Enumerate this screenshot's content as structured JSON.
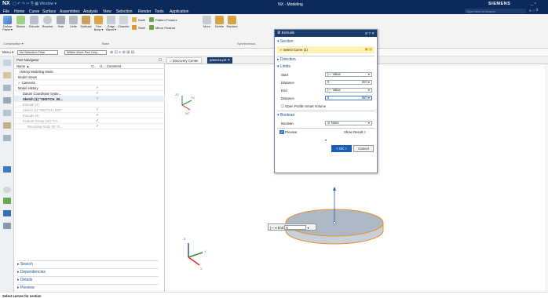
{
  "titlebar": {
    "app": "NX",
    "title": "NX - Modeling",
    "brand": "SIEMENS",
    "window_menu": "Window ▾"
  },
  "menubar": {
    "tabs": [
      "File",
      "Home",
      "Curve",
      "Surface",
      "Assemblies",
      "Analysis",
      "View",
      "Selection",
      "Render",
      "Tools",
      "Application"
    ],
    "active": "Home",
    "search_placeholder": "Type Here to Search"
  },
  "ribbon": {
    "buttons": [
      "Datum Plane ▾",
      "Sketch",
      "Extrude",
      "Revolve",
      "Hole",
      "Unite",
      "Subtract",
      "Trim Body ▾",
      "Edge Blend ▾",
      "Chamfer",
      "More",
      "Delete",
      "Replace"
    ],
    "small": [
      "Draft",
      "Pattern Feature",
      "Shell",
      "Mirror Feature"
    ],
    "groups": [
      "Construction ▾",
      "Base",
      "Synchronous"
    ]
  },
  "selbar": {
    "menu": "Menu ▾",
    "filter": "No Selection Filter",
    "scope": "Within Work Part Only"
  },
  "nav": {
    "title": "Part Navigator",
    "cols": [
      "Name ▲",
      "C...",
      "U...",
      "Comment"
    ],
    "rows": [
      {
        "label": "History Modeling Mode",
        "indent": 4,
        "chk": ""
      },
      {
        "label": "Model Views",
        "indent": 2,
        "chk": ""
      },
      {
        "label": "✓ Cameras",
        "indent": 2,
        "chk": ""
      },
      {
        "label": "Model History",
        "indent": 2,
        "chk": "✓"
      },
      {
        "label": "Datum Coordinate Syste...",
        "indent": 8,
        "chk": "✓"
      },
      {
        "label": "Sketch (1) \"SKETCH_00...",
        "indent": 8,
        "chk": "✓",
        "bold": true
      },
      {
        "label": "Extrude (2)",
        "indent": 8,
        "chk": "",
        "dim": true
      },
      {
        "label": "Sketch (3) \"SKETCH_001\"",
        "indent": 8,
        "chk": "✓",
        "dim": true
      },
      {
        "label": "Extrude (4)",
        "indent": 8,
        "chk": "✓",
        "dim": true
      },
      {
        "label": "Feature Group (10) \"CA...",
        "indent": 8,
        "chk": "✓",
        "dim": true
      },
      {
        "label": "Revolving Body (8) \"R...",
        "indent": 14,
        "chk": "✓",
        "dim": true
      }
    ],
    "sections": [
      "Search",
      "Dependencies",
      "Details",
      "Preview"
    ]
  },
  "tabs": {
    "discovery": "Discovery Center",
    "part": "patsoza.prt ✕"
  },
  "dialog": {
    "title": "Extrude",
    "section": "Section",
    "select_curve": "✓ Select Curve (1)",
    "direction": "Direction",
    "limits": "Limits",
    "start_label": "Start",
    "start_value": "|— Value",
    "dist1_label": "Distance",
    "dist1_value": "0",
    "unit": "mm",
    "end_label": "End",
    "end_value": "|— Value",
    "dist2_label": "Distance",
    "dist2_value": "5",
    "open_profile": "Open Profile Smart Volume",
    "boolean_sec": "Boolean",
    "boolean_label": "Boolean",
    "boolean_value": "None",
    "preview": "Preview",
    "show_result": "Show Result",
    "ok": "< OK >",
    "cancel": "Cancel"
  },
  "onscreen": {
    "end_label": "End",
    "end_value": "5",
    "type": "|— ▾"
  },
  "axes": {
    "zc": "ZC",
    "yc": "YC",
    "xc": "XC",
    "z": "Z",
    "y": "Y",
    "x": "X"
  },
  "status": "Select curves for section"
}
